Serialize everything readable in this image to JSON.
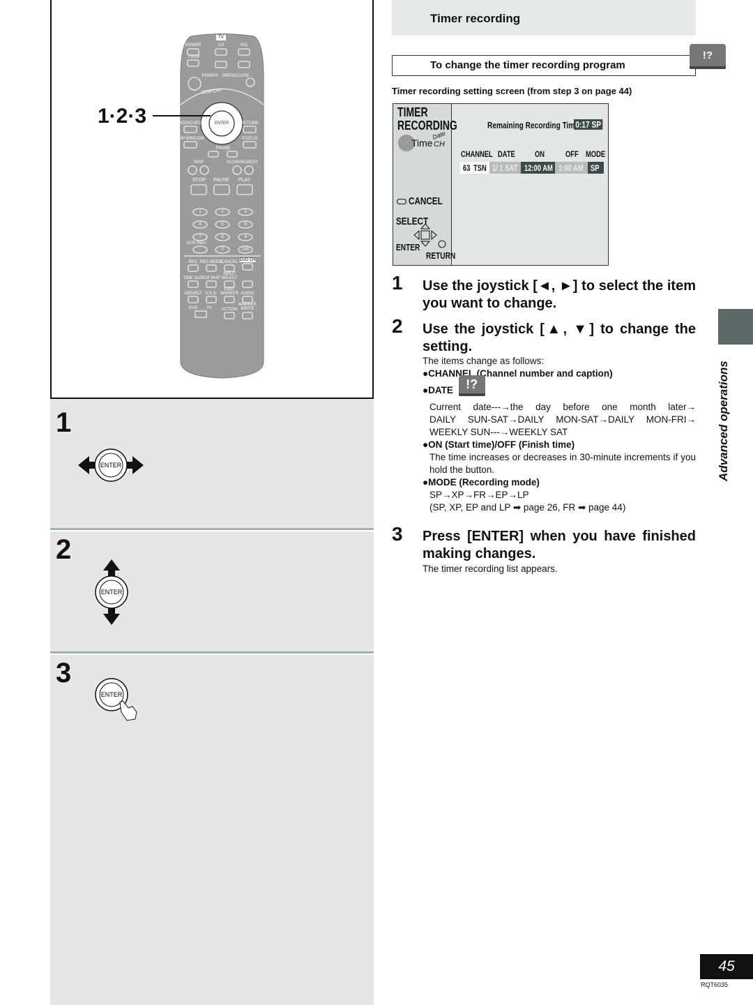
{
  "left": {
    "callout": "1·2·3",
    "steps": [
      "1",
      "2",
      "3"
    ],
    "enter_label": "ENTER",
    "remote": {
      "tv": "TV",
      "power": "POWER",
      "ch": "CH",
      "vol": "VOL",
      "tvav": "TV/AV",
      "power2": "POWER",
      "openclose": "OPEN/CLOSE",
      "display": "DISPLAY",
      "prog_check": "PROG/CHECK",
      "return": "RETURN",
      "top_window": "TOP WINDOW",
      "status": "STATUS",
      "frame": "FRAME",
      "skip": "SKIP",
      "slow_search": "SLOW/SEARCH",
      "stop": "STOP",
      "pause": "PAUSE",
      "play": "PLAY",
      "numbers": [
        "1",
        "2",
        "3",
        "4",
        "5",
        "6",
        "7",
        "8",
        "9",
        "0",
        "100"
      ],
      "vcrplus": "VCR Plus+",
      "rec": "REC",
      "rec_mode": "REC MODE",
      "cancel": "CANCEL",
      "time_slip": "TIME SLIP",
      "cm_skip": "CM SKIP",
      "input_select": "INPUT SELECT",
      "add_dlt": "ADD/DLT",
      "vss": "V.S.S.",
      "last_marker": "LAST MARKER",
      "audio": "AUDIO",
      "dvd": "DVD",
      "tv2": "TV",
      "action": "ACTION",
      "marker_write": "MARKER WRITE",
      "dvd_ch": "DVD CH"
    }
  },
  "header": {
    "title": "Timer recording"
  },
  "subheader": {
    "title": "To change the timer recording program",
    "icon": "!?"
  },
  "caption": "Timer recording setting screen (from step 3 on page 44)",
  "screen": {
    "title1": "TIMER",
    "title2": "RECORDING",
    "time": "Time",
    "date": "Date",
    "ch": "CH",
    "remaining_label": "Remaining Recording Time",
    "remaining_value": "0:17 SP",
    "columns": [
      "CHANNEL",
      "DATE",
      "ON",
      "OFF",
      "MODE"
    ],
    "row": {
      "channel": "63",
      "caption": "TSN",
      "date": "1/ 1 SAT",
      "on": "12:00 AM",
      "off": "1:00 AM",
      "mode": "SP"
    },
    "cancel": "CANCEL",
    "select": "SELECT",
    "enter": "ENTER",
    "return": "RETURN"
  },
  "steps": [
    {
      "num": "1",
      "title": "Use the joystick [◄, ►] to select the item you want to change."
    },
    {
      "num": "2",
      "title": "Use the joystick [▲, ▼] to change the setting."
    },
    {
      "num": "3",
      "title": "Press [ENTER] when you have finished making changes.",
      "body": "The timer recording list appears."
    }
  ],
  "step2_body": {
    "intro": "The items change as follows:",
    "channel": "●CHANNEL (Channel number and caption)",
    "date": "●DATE",
    "date_icon": "!?",
    "date_text1": "Current date---→the day before one month later→",
    "date_text2": "DAILY SUN-SAT→DAILY MON-SAT→DAILY MON-FRI→",
    "date_text3": "WEEKLY SUN---→WEEKLY SAT",
    "onoff": "●ON (Start time)/OFF (Finish time)",
    "onoff_text": "The time increases or decreases in 30-minute increments if you hold the button.",
    "mode": "●MODE (Recording mode)",
    "mode_text1": "SP→XP→FR→EP→LP",
    "mode_text2": "(SP, XP, EP and LP ➡ page 26, FR ➡ page 44)"
  },
  "side_label": "Advanced operations",
  "page_number": "45",
  "doc_code": "RQT6035"
}
